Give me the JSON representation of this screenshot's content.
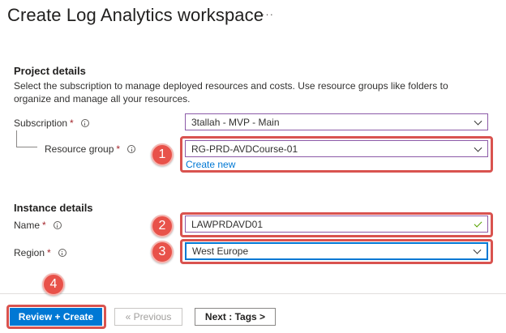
{
  "header": {
    "title": "Create Log Analytics workspace",
    "more": "···"
  },
  "project_details": {
    "title": "Project details",
    "description": "Select the subscription to manage deployed resources and costs. Use resource groups like folders to organize and manage all your resources.",
    "subscription": {
      "label": "Subscription",
      "required": "*",
      "value": "3tallah - MVP - Main"
    },
    "resource_group": {
      "label": "Resource group",
      "required": "*",
      "value": "RG-PRD-AVDCourse-01",
      "create_new": "Create new"
    }
  },
  "instance_details": {
    "title": "Instance details",
    "name": {
      "label": "Name",
      "required": "*",
      "value": "LAWPRDAVD01"
    },
    "region": {
      "label": "Region",
      "required": "*",
      "value": "West Europe"
    }
  },
  "callouts": [
    "1",
    "2",
    "3",
    "4"
  ],
  "footer": {
    "review_create": "Review + Create",
    "previous": "« Previous",
    "next": "Next : Tags >"
  },
  "colors": {
    "accent": "#0078d4",
    "callout": "#e8524a",
    "valid": "#57a300"
  }
}
